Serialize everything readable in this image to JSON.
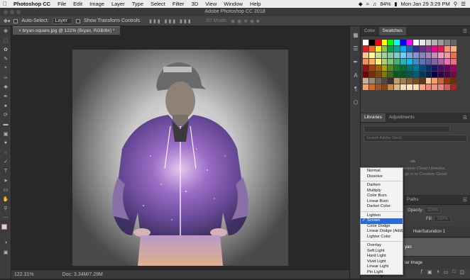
{
  "menubar": {
    "items": [
      "Photoshop CC",
      "File",
      "Edit",
      "Image",
      "Layer",
      "Type",
      "Select",
      "Filter",
      "3D",
      "View",
      "Window",
      "Help"
    ],
    "clock": "Mon Jan 29  3:29 PM",
    "battery": "84%"
  },
  "window_title": "Adobe Photoshop CC 2018",
  "options": {
    "auto_select_label": "Auto-Select:",
    "auto_select_value": "Layer",
    "transform_label": "Show Transform Controls",
    "mode_label": "3D Mode:"
  },
  "document": {
    "tab": "bryan-square.jpg @ 122% (Bryan, RGB/8#) *",
    "zoom": "122.31%",
    "doc_size": "Doc: 3.34M/7.29M"
  },
  "panels": {
    "color_tab": "Color",
    "swatches_tab": "Swatches",
    "libraries_tab": "Libraries",
    "adjustments_tab": "Adjustments",
    "search_placeholder": "Search Adobe Stock",
    "cc_message_1": "reative Cloud Libraries,",
    "cc_message_2": "gn in to Creative Cloud",
    "paths_tab": "Paths",
    "opacity_label": "Opacity:",
    "opacity_value": "100%",
    "fill_label": "Fill:",
    "fill_value": "100%",
    "layer_hue": "Hue/Saturation 1",
    "layer_bryan": "yan",
    "layer_bg": "lar Image"
  },
  "blend_modes": {
    "group1": [
      "Normal",
      "Dissolve"
    ],
    "group2": [
      "Darken",
      "Multiply",
      "Color Burn",
      "Linear Burn",
      "Darker Color"
    ],
    "group3": [
      "Lighten",
      "Screen",
      "Color Dodge",
      "Linear Dodge (Add)",
      "Lighter Color"
    ],
    "group4": [
      "Overlay",
      "Soft Light",
      "Hard Light",
      "Vivid Light",
      "Linear Light",
      "Pin Light"
    ],
    "selected": "Screen"
  },
  "icons": {
    "tools": [
      "move-icon",
      "marquee-icon",
      "lasso-icon",
      "quick-select-icon",
      "crop-icon",
      "eyedropper-icon",
      "healing-icon",
      "brush-icon",
      "stamp-icon",
      "history-brush-icon",
      "eraser-icon",
      "gradient-icon",
      "blur-icon",
      "dodge-icon",
      "pen-icon",
      "type-icon",
      "path-select-icon",
      "shape-icon",
      "hand-icon",
      "zoom-icon",
      "more-icon"
    ]
  }
}
